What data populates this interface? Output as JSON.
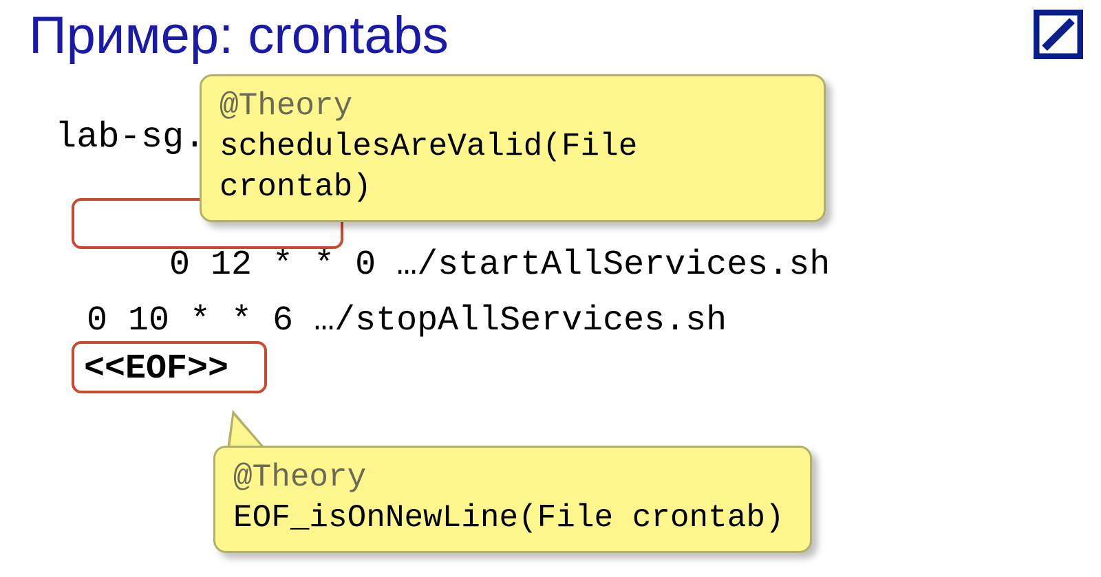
{
  "title": "Пример: crontabs",
  "filename": "lab-sg.cron",
  "cron": {
    "line1_schedule": "0 12 * * 0",
    "line1_cmd": " …/startAllServices.sh",
    "line2": "0 10 * * 6 …/stopAllServices.sh",
    "eof": "<<EOF>>"
  },
  "callout1": {
    "annotation": "@Theory",
    "signature": "schedulesAreValid(File crontab)"
  },
  "callout2": {
    "annotation": "@Theory",
    "signature": "EOF_isOnNewLine(File crontab)"
  },
  "logo": {
    "border_color": "#0a1e8a",
    "slash_color": "#0a1e8a"
  }
}
